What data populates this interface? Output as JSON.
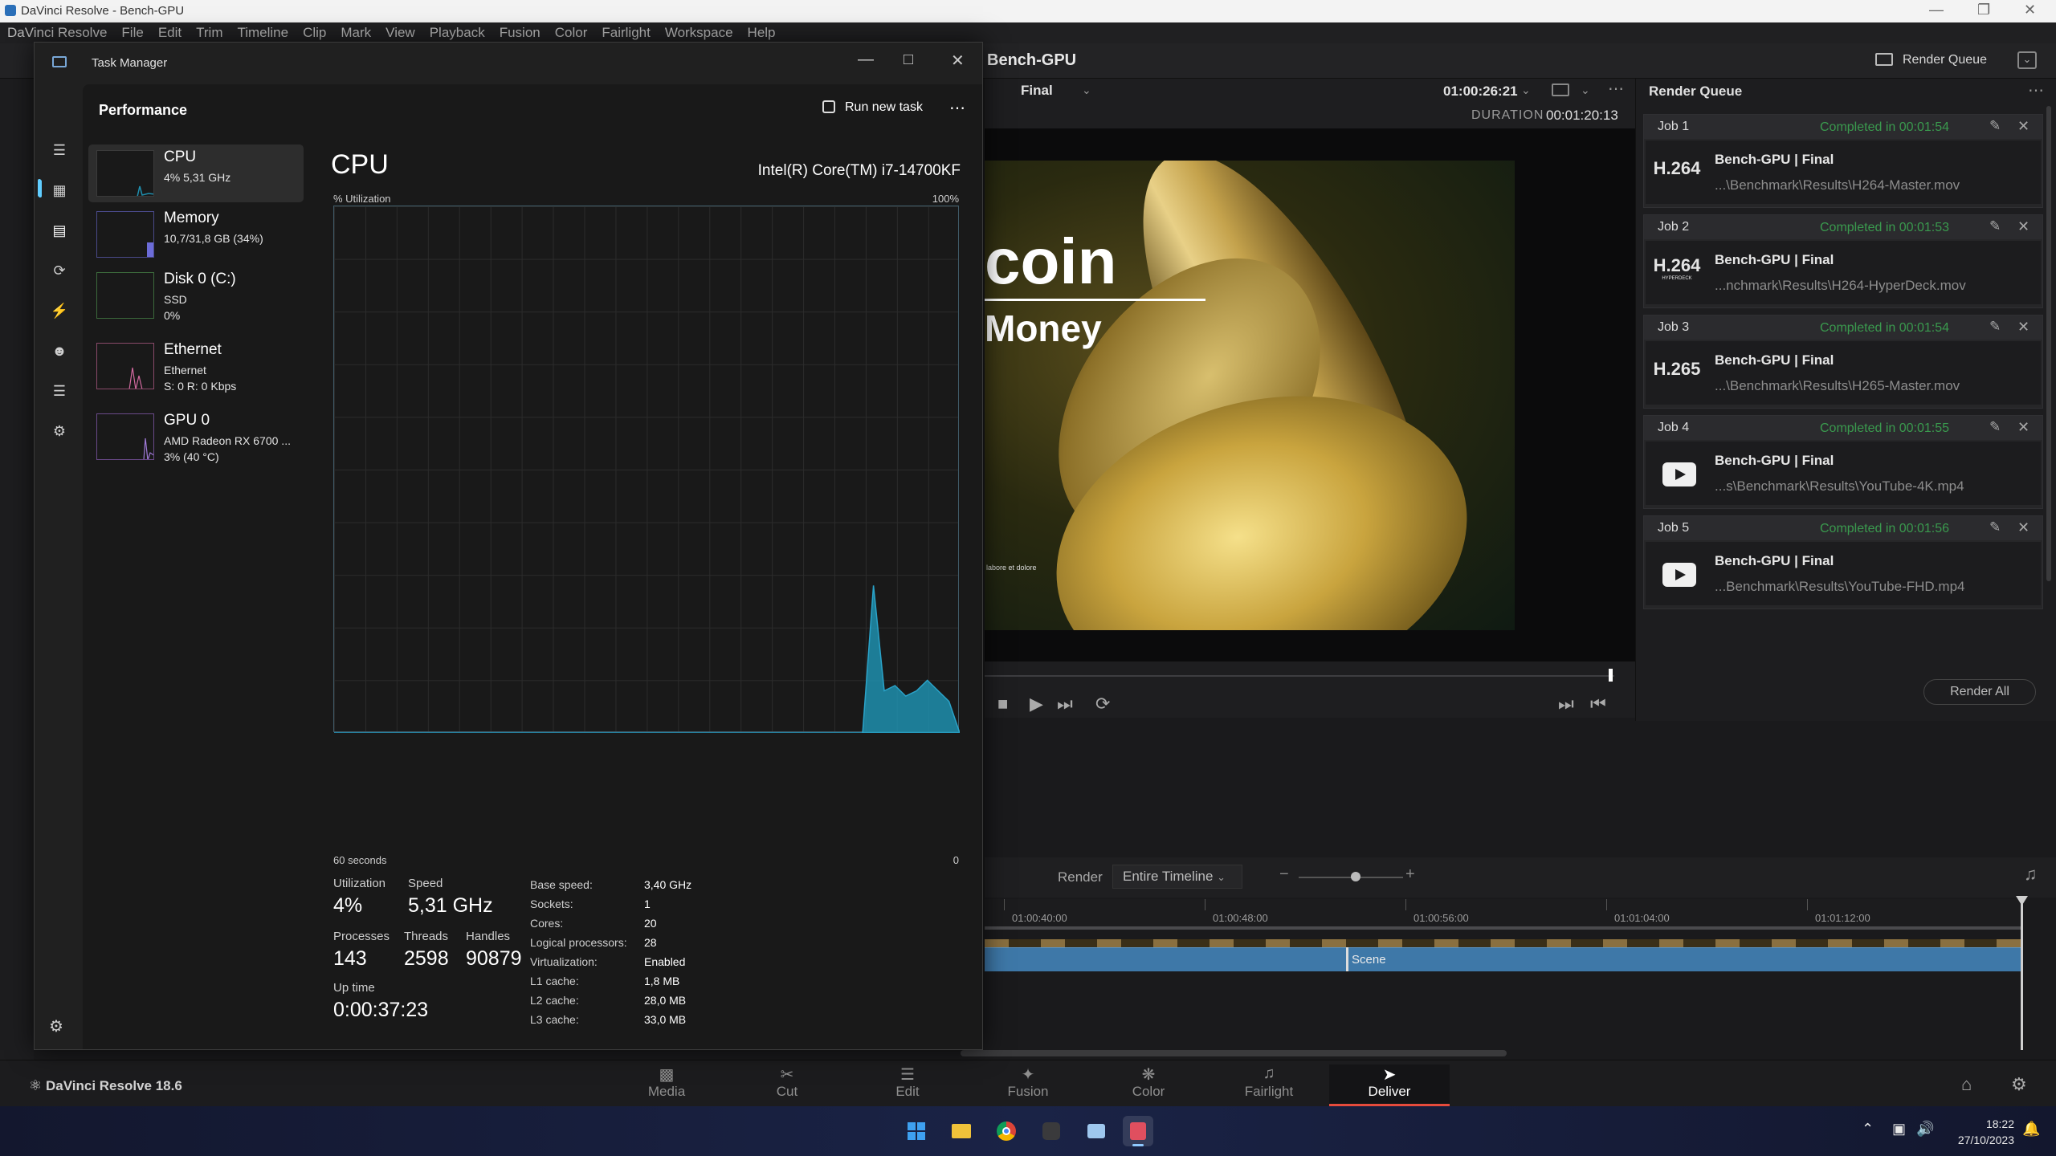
{
  "davinci": {
    "window_title": "DaVinci Resolve - Bench-GPU",
    "menu": [
      "DaVinci Resolve",
      "File",
      "Edit",
      "Trim",
      "Timeline",
      "Clip",
      "Mark",
      "View",
      "Playback",
      "Fusion",
      "Color",
      "Fairlight",
      "Workspace",
      "Help"
    ],
    "project_title": "Bench-GPU",
    "render_queue_button": "Render Queue",
    "viewer": {
      "preset": "Final",
      "timecode": "01:00:26:21",
      "duration_label": "DURATION",
      "duration": "00:01:20:13"
    },
    "preview_text": {
      "title_fragment": "coin",
      "subtitle_fragment": "Money",
      "footer_text": "labore et dolore"
    },
    "render_queue": {
      "title": "Render Queue",
      "render_all": "Render All",
      "jobs": [
        {
          "id": "Job 1",
          "status": "Completed in 00:01:54",
          "codec": "H.264",
          "codec_sub": "",
          "title": "Bench-GPU | Final",
          "path": "...\\Benchmark\\Results\\H264-Master.mov"
        },
        {
          "id": "Job 2",
          "status": "Completed in 00:01:53",
          "codec": "H.264",
          "codec_sub": "HYPERDECK",
          "title": "Bench-GPU | Final",
          "path": "...nchmark\\Results\\H264-HyperDeck.mov"
        },
        {
          "id": "Job 3",
          "status": "Completed in 00:01:54",
          "codec": "H.265",
          "codec_sub": "",
          "title": "Bench-GPU | Final",
          "path": "...\\Benchmark\\Results\\H265-Master.mov"
        },
        {
          "id": "Job 4",
          "status": "Completed in 00:01:55",
          "codec": "youtube",
          "codec_sub": "",
          "title": "Bench-GPU | Final",
          "path": "...s\\Benchmark\\Results\\YouTube-4K.mp4"
        },
        {
          "id": "Job 5",
          "status": "Completed in 00:01:56",
          "codec": "youtube",
          "codec_sub": "",
          "title": "Bench-GPU | Final",
          "path": "...Benchmark\\Results\\YouTube-FHD.mp4"
        }
      ]
    },
    "timeline": {
      "render_label": "Render",
      "render_range": "Entire Timeline",
      "ticks": [
        "01:00:40:00",
        "01:00:48:00",
        "01:00:56:00",
        "01:01:04:00",
        "01:01:12:00"
      ],
      "clip_label": "Scene"
    },
    "pages": [
      "Media",
      "Cut",
      "Edit",
      "Fusion",
      "Color",
      "Fairlight",
      "Deliver"
    ],
    "active_page": "Deliver",
    "brand": "DaVinci Resolve 18.6"
  },
  "task_manager": {
    "title": "Task Manager",
    "section": "Performance",
    "run_new_task": "Run new task",
    "resources": [
      {
        "name": "CPU",
        "lines": [
          "4% 5,31 GHz"
        ]
      },
      {
        "name": "Memory",
        "lines": [
          "10,7/31,8 GB (34%)"
        ]
      },
      {
        "name": "Disk 0 (C:)",
        "lines": [
          "SSD",
          "0%"
        ]
      },
      {
        "name": "Ethernet",
        "lines": [
          "Ethernet",
          "S: 0 R: 0 Kbps"
        ]
      },
      {
        "name": "GPU 0",
        "lines": [
          "AMD Radeon RX 6700 ...",
          "3% (40 °C)"
        ]
      }
    ],
    "cpu": {
      "heading": "CPU",
      "model": "Intel(R) Core(TM) i7-14700KF",
      "graph_label": "% Utilization",
      "graph_max": "100%",
      "x_left": "60 seconds",
      "x_right": "0",
      "utilization_series": [
        0,
        0,
        0,
        0,
        0,
        0,
        0,
        0,
        0,
        0,
        0,
        0,
        0,
        0,
        0,
        0,
        0,
        0,
        0,
        0,
        0,
        0,
        0,
        0,
        0,
        0,
        0,
        0,
        0,
        0,
        0,
        0,
        0,
        0,
        0,
        0,
        0,
        0,
        0,
        0,
        0,
        0,
        0,
        0,
        0,
        0,
        0,
        0,
        0,
        0,
        28,
        8,
        9,
        7,
        8,
        10,
        8,
        6,
        0
      ],
      "stats": {
        "utilization_label": "Utilization",
        "utilization": "4%",
        "speed_label": "Speed",
        "speed": "5,31 GHz",
        "processes_label": "Processes",
        "processes": "143",
        "threads_label": "Threads",
        "threads": "2598",
        "handles_label": "Handles",
        "handles": "90879",
        "uptime_label": "Up time",
        "uptime": "0:00:37:23"
      },
      "specs": [
        {
          "k": "Base speed:",
          "v": "3,40 GHz"
        },
        {
          "k": "Sockets:",
          "v": "1"
        },
        {
          "k": "Cores:",
          "v": "20"
        },
        {
          "k": "Logical processors:",
          "v": "28"
        },
        {
          "k": "Virtualization:",
          "v": "Enabled"
        },
        {
          "k": "L1 cache:",
          "v": "1,8 MB"
        },
        {
          "k": "L2 cache:",
          "v": "28,0 MB"
        },
        {
          "k": "L3 cache:",
          "v": "33,0 MB"
        }
      ]
    }
  },
  "taskbar": {
    "time": "18:22",
    "date": "27/10/2023"
  },
  "colors": {
    "accent": "#60cdff",
    "graph_fill": "#1f8fae",
    "completed": "#3a9a4e",
    "deliver_underline": "#e64b3c"
  }
}
